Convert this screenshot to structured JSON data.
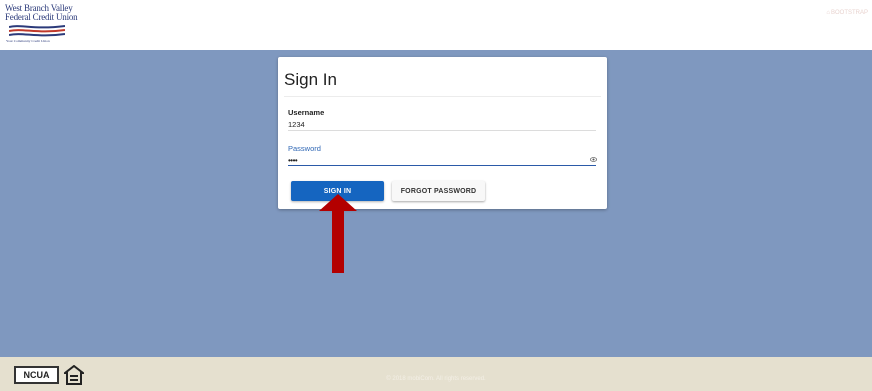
{
  "header": {
    "logo_line1": "West Branch Valley",
    "logo_line2": "Federal Credit Union",
    "logo_tagline": "Your Community Credit Union",
    "home_link": "BOOTSTRAP"
  },
  "signin": {
    "title": "Sign In",
    "username_label": "Username",
    "username_value": "1234",
    "password_label": "Password",
    "password_value": "••••",
    "signin_button": "SIGN IN",
    "forgot_button": "FORGOT PASSWORD"
  },
  "footer": {
    "ncua_label": "NCUA",
    "copyright": "© 2018 mobiCom. All rights reserved."
  },
  "colors": {
    "background": "#7f98bf",
    "primary_button": "#1565c0",
    "annotation_arrow": "#b30000",
    "footer": "#e5e0cf"
  }
}
